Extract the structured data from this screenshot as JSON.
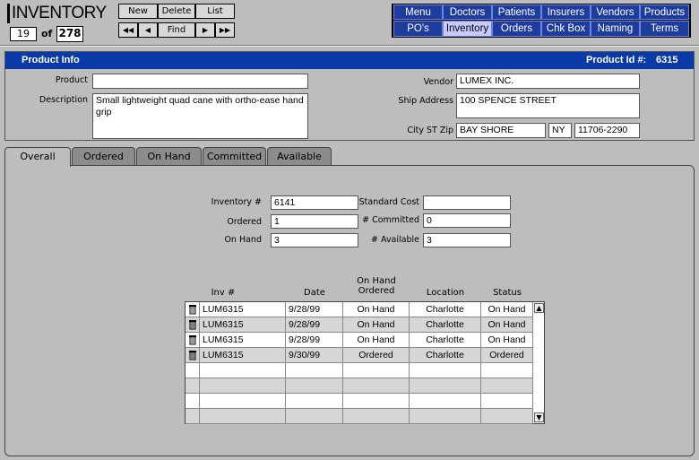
{
  "app": {
    "title": "INVENTORY"
  },
  "record": {
    "current": "19",
    "of_label": "of",
    "total": "278"
  },
  "toolbar": {
    "new_label": "New",
    "delete_label": "Delete",
    "list_label": "List",
    "first_label": "◀◀",
    "prev_label": "◀",
    "find_label": "Find",
    "next_label": "▶",
    "last_label": "▶▶"
  },
  "nav": {
    "row1": [
      "Menu",
      "Doctors",
      "Patients",
      "Insurers",
      "Vendors",
      "Products"
    ],
    "row2": [
      "PO's",
      "Inventory",
      "Orders",
      "Chk Box",
      "Naming",
      "Terms"
    ],
    "active": "Inventory"
  },
  "product_info": {
    "header": "Product Info",
    "product_id_label": "Product Id #:",
    "product_id": "6315",
    "product_label": "Product",
    "product_value": "",
    "description_label": "Description",
    "description_value": "Small lightweight quad cane with ortho-ease hand grip",
    "vendor_label": "Vendor",
    "vendor_value": "LUMEX INC.",
    "ship_address_label": "Ship Address",
    "ship_address_value": "100 SPENCE STREET",
    "city_st_zip_label": "City ST Zip",
    "city_value": "BAY SHORE",
    "state_value": "NY",
    "zip_value": "11706-2290"
  },
  "tabs": [
    "Overall",
    "Ordered",
    "On Hand",
    "Committed",
    "Available"
  ],
  "overall": {
    "inventory_num_label": "Inventory #",
    "inventory_num": "6141",
    "ordered_label": "Ordered",
    "ordered": "1",
    "on_hand_label": "On Hand",
    "on_hand": "3",
    "standard_cost_label": "Standard Cost",
    "standard_cost": "",
    "committed_label": "# Committed",
    "committed": "0",
    "available_label": "# Available",
    "available": "3"
  },
  "table": {
    "headers": {
      "inv": "Inv #",
      "date": "Date",
      "onhand_ordered": "On Hand Ordered",
      "location": "Location",
      "status": "Status"
    },
    "rows": [
      {
        "inv": "LUM6315",
        "date": "9/28/99",
        "onhand_ordered": "On Hand",
        "location": "Charlotte",
        "status": "On Hand"
      },
      {
        "inv": "LUM6315",
        "date": "9/28/99",
        "onhand_ordered": "On Hand",
        "location": "Charlotte",
        "status": "On Hand"
      },
      {
        "inv": "LUM6315",
        "date": "9/28/99",
        "onhand_ordered": "On Hand",
        "location": "Charlotte",
        "status": "On Hand"
      },
      {
        "inv": "LUM6315",
        "date": "9/30/99",
        "onhand_ordered": "Ordered",
        "location": "Charlotte",
        "status": "Ordered"
      }
    ],
    "empty_rows": 4
  },
  "colors": {
    "nav_bg": "#1e3c9e",
    "nav_active": "#c9c9ff",
    "header_bg": "#0a3aa8",
    "window_bg": "#bdbdbd"
  },
  "icons": {
    "trash": "trash-icon",
    "scroll_up": "arrow-up-icon",
    "scroll_down": "arrow-down-icon"
  }
}
